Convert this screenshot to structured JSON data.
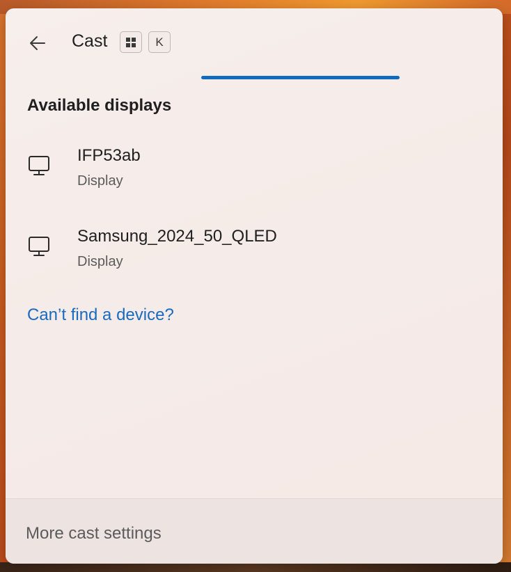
{
  "header": {
    "title": "Cast",
    "shortcut_win_icon": "windows-logo-icon",
    "shortcut_key": "K",
    "back_icon": "arrow-left-icon"
  },
  "section": {
    "title": "Available displays"
  },
  "devices": [
    {
      "name": "IFP53ab",
      "type": "Display",
      "icon": "monitor-icon"
    },
    {
      "name": "Samsung_2024_50_QLED",
      "type": "Display",
      "icon": "monitor-icon"
    }
  ],
  "help_link": "Can’t find a device?",
  "footer": {
    "settings_label": "More cast settings"
  },
  "colors": {
    "accent": "#0f6cbd",
    "link": "#1a6bbf"
  }
}
